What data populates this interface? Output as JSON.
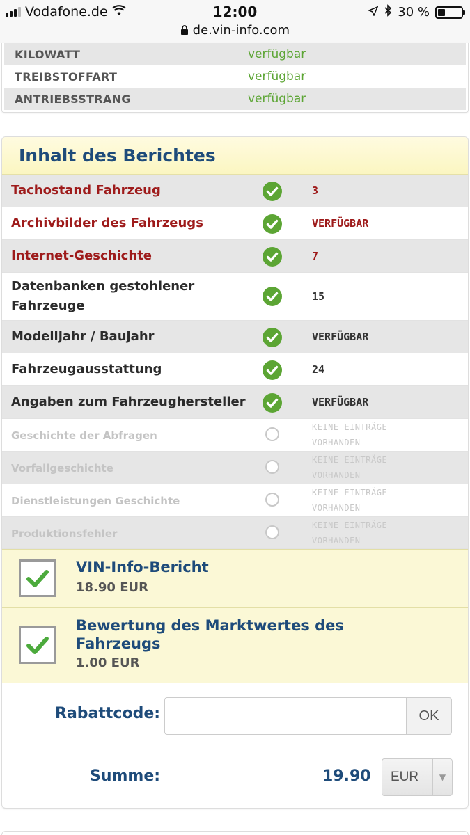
{
  "status_bar": {
    "carrier": "Vodafone.de",
    "time": "12:00",
    "url": "de.vin-info.com",
    "battery": "30 %"
  },
  "specs": [
    {
      "label": "KILOWATT",
      "value": "verfügbar"
    },
    {
      "label": "TREIBSTOFFART",
      "value": "verfügbar"
    },
    {
      "label": "ANTRIEBSSTRANG",
      "value": "verfügbar"
    }
  ],
  "report": {
    "title": "Inhalt des Berichtes",
    "items": [
      {
        "label": "Tachostand Fahrzeug",
        "value": "3"
      },
      {
        "label": "Archivbilder des Fahrzeugs",
        "value": "VERFÜGBAR"
      },
      {
        "label": "Internet-Geschichte",
        "value": "7"
      },
      {
        "label_line1": "Datenbanken gestohlener",
        "label_line2": "Fahrzeuge",
        "value": "15"
      },
      {
        "label": "Modelljahr / Baujahr",
        "value": "VERFÜGBAR"
      },
      {
        "label": "Fahrzeugausstattung",
        "value": "24"
      },
      {
        "label": "Angaben zum Fahrzeughersteller",
        "value": "VERFÜGBAR"
      },
      {
        "label": "Geschichte der Abfragen",
        "value_line1": "KEINE EINTRÄGE",
        "value_line2": "VORHANDEN"
      },
      {
        "label": "Vorfallgeschichte",
        "value_line1": "KEINE EINTRÄGE",
        "value_line2": "VORHANDEN"
      },
      {
        "label": "Dienstleistungen Geschichte",
        "value_line1": "KEINE EINTRÄGE",
        "value_line2": "VORHANDEN"
      },
      {
        "label": "Produktionsfehler",
        "value_line1": "KEINE EINTRÄGE",
        "value_line2": "VORHANDEN"
      }
    ]
  },
  "products": [
    {
      "name": "VIN-Info-Bericht",
      "price": "18.90 EUR"
    },
    {
      "name_line1": "Bewertung des Marktwertes des",
      "name_line2": "Fahrzeugs",
      "price": "1.00 EUR"
    }
  ],
  "discount": {
    "label": "Rabattcode:",
    "value": "",
    "button": "OK"
  },
  "total": {
    "label": "Summe:",
    "value": "19.90",
    "currency": "EUR"
  },
  "colors": {
    "available_green": "#5ca534",
    "title_blue": "#1e4b7a",
    "highlight_red": "#9e1b1b"
  }
}
